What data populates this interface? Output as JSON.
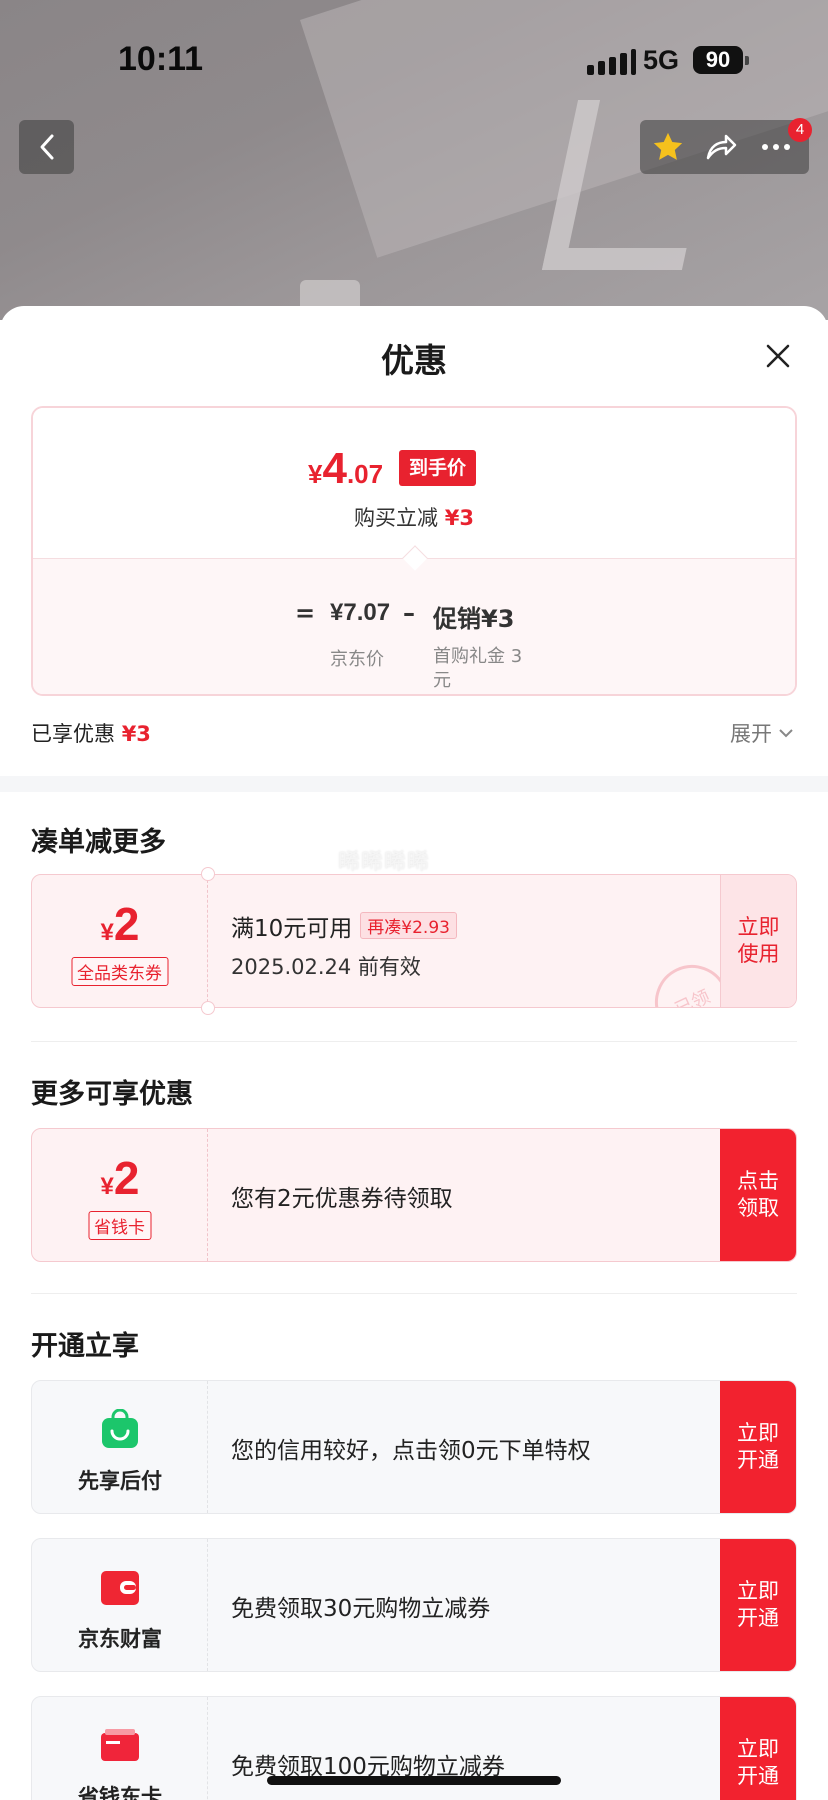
{
  "status_bar": {
    "time": "10:11",
    "network": "5G",
    "battery": "90"
  },
  "header": {
    "cart_badge": "4",
    "icons": [
      "back-icon",
      "star-icon",
      "share-icon",
      "more-icon"
    ]
  },
  "sheet": {
    "title": "优惠",
    "price": {
      "yen": "¥",
      "int": "4",
      "dec": ".07",
      "tag": "到手价"
    },
    "reduce_label": "购买立减",
    "reduce_value": "¥3",
    "formula": {
      "eq": "=",
      "jd_price": "¥7.07",
      "minus": "–",
      "promo": "促销¥3",
      "jd_label": "京东价",
      "promo_label": "首购礼金 3元"
    },
    "enjoyed_label": "已享优惠",
    "enjoyed_value": "¥3",
    "expand_label": "展开"
  },
  "watermark": "晞晞晞晞",
  "section1": {
    "title": "凑单减更多",
    "coupon": {
      "yen": "¥",
      "value": "2",
      "tag": "全品类东券",
      "line1": "满10元可用",
      "again": "再凑¥2.93",
      "line2": "2025.02.24 前有效",
      "action": "立即使用",
      "stamp": "已领"
    }
  },
  "section2": {
    "title": "更多可享优惠",
    "coupon": {
      "yen": "¥",
      "value": "2",
      "tag": "省钱卡",
      "text": "您有2元优惠券待领取",
      "action": "点击领取"
    }
  },
  "section3": {
    "title": "开通立享",
    "items": [
      {
        "name": "先享后付",
        "text": "您的信用较好，点击领0元下单特权",
        "action": "立即开通",
        "icon": "bag-icon"
      },
      {
        "name": "京东财富",
        "text": "免费领取30元购物立减券",
        "action": "立即开通",
        "icon": "wallet-icon"
      },
      {
        "name": "省钱东卡",
        "text": "免费领取100元购物立减券",
        "action": "立即开通",
        "icon": "card-icon"
      }
    ]
  },
  "colors": {
    "accent": "#e8222f",
    "pink_bg": "#fef2f3"
  }
}
